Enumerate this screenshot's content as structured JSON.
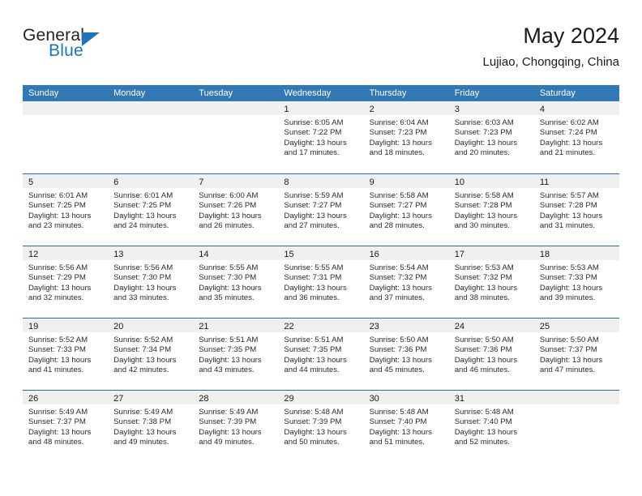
{
  "brand": {
    "name_part1": "General",
    "name_part2": "Blue",
    "triangle_icon": "brand-triangle-icon",
    "color_dark": "#231f20",
    "color_blue": "#1b75bb"
  },
  "header": {
    "title": "May 2024",
    "subtitle": "Lujiao, Chongqing, China"
  },
  "theme": {
    "header_bg": "#3079b6",
    "header_text": "#ffffff",
    "day_strip_bg": "#f0f0f0",
    "cell_bg": "#ffffff",
    "row_divider": "#2c6ca4"
  },
  "weekdays": [
    "Sunday",
    "Monday",
    "Tuesday",
    "Wednesday",
    "Thursday",
    "Friday",
    "Saturday"
  ],
  "weeks": [
    [
      {
        "day": "",
        "lines": []
      },
      {
        "day": "",
        "lines": []
      },
      {
        "day": "",
        "lines": []
      },
      {
        "day": "1",
        "lines": [
          "Sunrise: 6:05 AM",
          "Sunset: 7:22 PM",
          "Daylight: 13 hours",
          "and 17 minutes."
        ]
      },
      {
        "day": "2",
        "lines": [
          "Sunrise: 6:04 AM",
          "Sunset: 7:23 PM",
          "Daylight: 13 hours",
          "and 18 minutes."
        ]
      },
      {
        "day": "3",
        "lines": [
          "Sunrise: 6:03 AM",
          "Sunset: 7:23 PM",
          "Daylight: 13 hours",
          "and 20 minutes."
        ]
      },
      {
        "day": "4",
        "lines": [
          "Sunrise: 6:02 AM",
          "Sunset: 7:24 PM",
          "Daylight: 13 hours",
          "and 21 minutes."
        ]
      }
    ],
    [
      {
        "day": "5",
        "lines": [
          "Sunrise: 6:01 AM",
          "Sunset: 7:25 PM",
          "Daylight: 13 hours",
          "and 23 minutes."
        ]
      },
      {
        "day": "6",
        "lines": [
          "Sunrise: 6:01 AM",
          "Sunset: 7:25 PM",
          "Daylight: 13 hours",
          "and 24 minutes."
        ]
      },
      {
        "day": "7",
        "lines": [
          "Sunrise: 6:00 AM",
          "Sunset: 7:26 PM",
          "Daylight: 13 hours",
          "and 26 minutes."
        ]
      },
      {
        "day": "8",
        "lines": [
          "Sunrise: 5:59 AM",
          "Sunset: 7:27 PM",
          "Daylight: 13 hours",
          "and 27 minutes."
        ]
      },
      {
        "day": "9",
        "lines": [
          "Sunrise: 5:58 AM",
          "Sunset: 7:27 PM",
          "Daylight: 13 hours",
          "and 28 minutes."
        ]
      },
      {
        "day": "10",
        "lines": [
          "Sunrise: 5:58 AM",
          "Sunset: 7:28 PM",
          "Daylight: 13 hours",
          "and 30 minutes."
        ]
      },
      {
        "day": "11",
        "lines": [
          "Sunrise: 5:57 AM",
          "Sunset: 7:28 PM",
          "Daylight: 13 hours",
          "and 31 minutes."
        ]
      }
    ],
    [
      {
        "day": "12",
        "lines": [
          "Sunrise: 5:56 AM",
          "Sunset: 7:29 PM",
          "Daylight: 13 hours",
          "and 32 minutes."
        ]
      },
      {
        "day": "13",
        "lines": [
          "Sunrise: 5:56 AM",
          "Sunset: 7:30 PM",
          "Daylight: 13 hours",
          "and 33 minutes."
        ]
      },
      {
        "day": "14",
        "lines": [
          "Sunrise: 5:55 AM",
          "Sunset: 7:30 PM",
          "Daylight: 13 hours",
          "and 35 minutes."
        ]
      },
      {
        "day": "15",
        "lines": [
          "Sunrise: 5:55 AM",
          "Sunset: 7:31 PM",
          "Daylight: 13 hours",
          "and 36 minutes."
        ]
      },
      {
        "day": "16",
        "lines": [
          "Sunrise: 5:54 AM",
          "Sunset: 7:32 PM",
          "Daylight: 13 hours",
          "and 37 minutes."
        ]
      },
      {
        "day": "17",
        "lines": [
          "Sunrise: 5:53 AM",
          "Sunset: 7:32 PM",
          "Daylight: 13 hours",
          "and 38 minutes."
        ]
      },
      {
        "day": "18",
        "lines": [
          "Sunrise: 5:53 AM",
          "Sunset: 7:33 PM",
          "Daylight: 13 hours",
          "and 39 minutes."
        ]
      }
    ],
    [
      {
        "day": "19",
        "lines": [
          "Sunrise: 5:52 AM",
          "Sunset: 7:33 PM",
          "Daylight: 13 hours",
          "and 41 minutes."
        ]
      },
      {
        "day": "20",
        "lines": [
          "Sunrise: 5:52 AM",
          "Sunset: 7:34 PM",
          "Daylight: 13 hours",
          "and 42 minutes."
        ]
      },
      {
        "day": "21",
        "lines": [
          "Sunrise: 5:51 AM",
          "Sunset: 7:35 PM",
          "Daylight: 13 hours",
          "and 43 minutes."
        ]
      },
      {
        "day": "22",
        "lines": [
          "Sunrise: 5:51 AM",
          "Sunset: 7:35 PM",
          "Daylight: 13 hours",
          "and 44 minutes."
        ]
      },
      {
        "day": "23",
        "lines": [
          "Sunrise: 5:50 AM",
          "Sunset: 7:36 PM",
          "Daylight: 13 hours",
          "and 45 minutes."
        ]
      },
      {
        "day": "24",
        "lines": [
          "Sunrise: 5:50 AM",
          "Sunset: 7:36 PM",
          "Daylight: 13 hours",
          "and 46 minutes."
        ]
      },
      {
        "day": "25",
        "lines": [
          "Sunrise: 5:50 AM",
          "Sunset: 7:37 PM",
          "Daylight: 13 hours",
          "and 47 minutes."
        ]
      }
    ],
    [
      {
        "day": "26",
        "lines": [
          "Sunrise: 5:49 AM",
          "Sunset: 7:37 PM",
          "Daylight: 13 hours",
          "and 48 minutes."
        ]
      },
      {
        "day": "27",
        "lines": [
          "Sunrise: 5:49 AM",
          "Sunset: 7:38 PM",
          "Daylight: 13 hours",
          "and 49 minutes."
        ]
      },
      {
        "day": "28",
        "lines": [
          "Sunrise: 5:49 AM",
          "Sunset: 7:39 PM",
          "Daylight: 13 hours",
          "and 49 minutes."
        ]
      },
      {
        "day": "29",
        "lines": [
          "Sunrise: 5:48 AM",
          "Sunset: 7:39 PM",
          "Daylight: 13 hours",
          "and 50 minutes."
        ]
      },
      {
        "day": "30",
        "lines": [
          "Sunrise: 5:48 AM",
          "Sunset: 7:40 PM",
          "Daylight: 13 hours",
          "and 51 minutes."
        ]
      },
      {
        "day": "31",
        "lines": [
          "Sunrise: 5:48 AM",
          "Sunset: 7:40 PM",
          "Daylight: 13 hours",
          "and 52 minutes."
        ]
      },
      {
        "day": "",
        "lines": []
      }
    ]
  ]
}
